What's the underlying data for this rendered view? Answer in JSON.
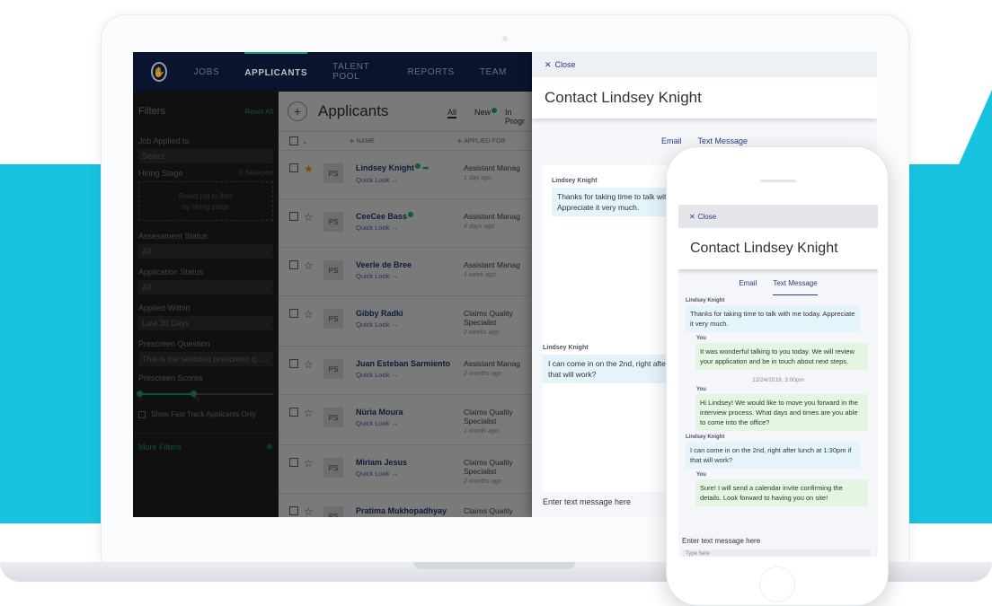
{
  "nav": {
    "items": [
      "JOBS",
      "APPLICANTS",
      "TALENT POOL",
      "REPORTS",
      "TEAM"
    ],
    "active": "APPLICANTS"
  },
  "filters": {
    "title": "Filters",
    "reset_label": "Reset All",
    "job_applied_label": "Job Applied to",
    "job_applied_value": "Select",
    "hiring_stage_label": "Hiring Stage",
    "hiring_stage_count": "0 Selected",
    "hiring_stage_hint_1": "Select job to filter",
    "hiring_stage_hint_2": "by hiring stage",
    "assessment_label": "Assessment Status",
    "assessment_value": "All",
    "application_label": "Application Status",
    "application_value": "All",
    "applied_within_label": "Applied Within",
    "applied_within_value": "Last 30 Days",
    "prescreen_q_label": "Prescreen Question",
    "prescreen_q_value": "This is the selected prescreen q...",
    "prescreen_scores_label": "Prescreen Scores",
    "slider_min": "0",
    "slider_max": "75",
    "fast_track_label": "Show Fast Track Applicants Only",
    "more_filters_label": "More Filters"
  },
  "applicants": {
    "title": "Applicants",
    "tabs": {
      "all": "All",
      "new": "New",
      "progress": "In Progr"
    },
    "col_name": "≑ NAME",
    "col_applied": "≑ APPLIED FOR",
    "quick_look": "Quick Look →",
    "rows": [
      {
        "initials": "PS",
        "name": "Lindsey Knight",
        "job": "Assistant Manag",
        "ago": "1 day ago",
        "starred": true
      },
      {
        "initials": "PS",
        "name": "CeeCee Bass",
        "job": "Assistant Manag",
        "ago": "4 days ago",
        "starred": false
      },
      {
        "initials": "PS",
        "name": "Veerle de Bree",
        "job": "Assistant Manag",
        "ago": "1 week ago",
        "starred": false
      },
      {
        "initials": "PS",
        "name": "Gibby Radki",
        "job": "Claims Quality Specialist",
        "ago": "2 weeks ago",
        "starred": false
      },
      {
        "initials": "PS",
        "name": "Juan Esteban Sarmiento",
        "job": "Assistant Manag",
        "ago": "2 months ago",
        "starred": false
      },
      {
        "initials": "PS",
        "name": "Núria Moura",
        "job": "Claims Quality Specialist",
        "ago": "1 month ago",
        "starred": false
      },
      {
        "initials": "PS",
        "name": "Miriam Jesus",
        "job": "Claims Quality Specialist",
        "ago": "2 months ago",
        "starred": false
      },
      {
        "initials": "PS",
        "name": "Pratima Mukhopadhyay",
        "job": "Claims Quality Specialist",
        "ago": "",
        "starred": false
      }
    ]
  },
  "contact": {
    "close_label": "Close",
    "title": "Contact Lindsey Knight",
    "tab_email": "Email",
    "tab_text": "Text Message",
    "entry_label": "Enter text message here",
    "input_placeholder": "Type here",
    "messages": [
      {
        "from": "Lindsey Knight",
        "side": "them",
        "text": "Thanks for taking time to talk with me today. Appreciate it very much."
      },
      {
        "from": "You",
        "side": "you",
        "text": "It was wonderful talking to you today. We will review your application and be in touch about next steps."
      },
      {
        "from": "",
        "side": "time",
        "text": "12/24/2019, 3:00pm"
      },
      {
        "from": "You",
        "side": "you",
        "text": "Hi Lindsey! We would like to move you forward in the interview process. What days and times are you able to come into the office?"
      },
      {
        "from": "Lindsey Knight",
        "side": "them",
        "text": "I can come in on the 2nd, right after lunch at 1:30pm if that will work?"
      },
      {
        "from": "You",
        "side": "you",
        "text": "Sure! I will send a calendar invite confirming the details. Look forward to having you on site!"
      }
    ],
    "laptop_msg_1_a": "Thanks for taking time to talk with",
    "laptop_msg_1_b": "Appreciate it very much.",
    "laptop_msg_2_a": "I can come in on the 2nd, right afte",
    "laptop_msg_2_b": "that will work?"
  },
  "colors": {
    "accent_cyan": "#18c3e0",
    "nav_bg": "#0d1b3f",
    "brand_green": "#17d18c",
    "them_bubble": "#e3f4fb",
    "you_bubble": "#e3f6e2"
  }
}
